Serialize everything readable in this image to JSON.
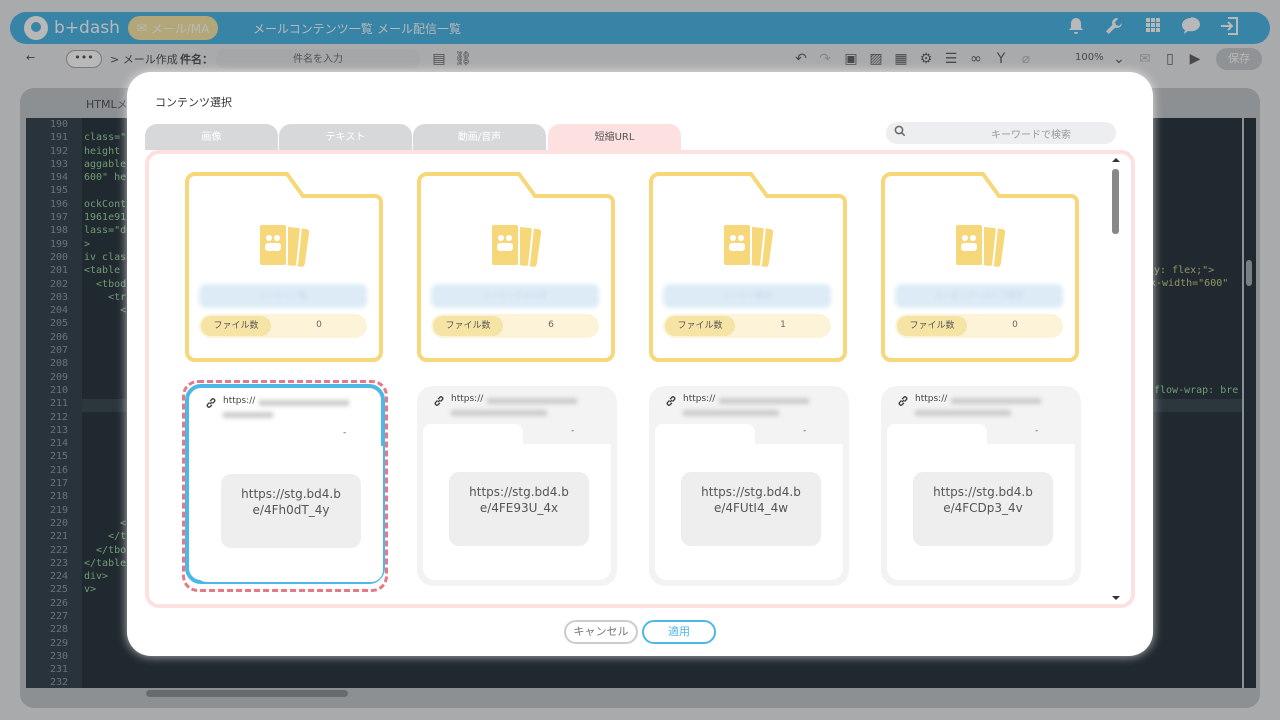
{
  "app": {
    "logo_text": "b+dash",
    "nav": {
      "mail_pill": "メール/MA",
      "item1": "メールコンテンツ一覧",
      "item2": "メール配信一覧"
    }
  },
  "subbar": {
    "back": "←",
    "dots": "•••",
    "breadcrumb": "> メール作成",
    "subject_label": "件名：",
    "subject_placeholder": "件名を入力",
    "zoom": "100%",
    "save": "保存"
  },
  "editor": {
    "tab_label": "HTMLメ",
    "line_numbers": [
      "190",
      "191",
      "192",
      "193",
      "194",
      "195",
      "196",
      "197",
      "198",
      "199",
      "200",
      "201",
      "202",
      "203",
      "204",
      "205",
      "206",
      "207",
      "208",
      "209",
      "210",
      "211",
      "212",
      "213",
      "214",
      "215",
      "216",
      "217",
      "218",
      "219",
      "220",
      "221",
      "222",
      "223",
      "224",
      "225",
      "226",
      "227",
      "228",
      "229",
      "230",
      "231",
      "232"
    ],
    "code_lines": [
      "",
      "class=\"",
      "height",
      "aggable",
      "600\" he",
      "",
      "ockCont",
      "1961e91",
      "lass=\"d",
      ">",
      "iv clas",
      "<table",
      "  <tbod",
      "    <tr",
      "      <",
      "",
      "",
      "",
      "",
      "",
      "",
      "",
      "",
      "",
      "",
      "",
      "",
      "",
      "",
      "",
      "      <",
      "    </t",
      "  </tbo",
      "</table",
      "div>",
      "v>",
      "",
      "",
      "",
      "",
      "",
      "",
      ""
    ],
    "right_code": {
      "line201": "y: flex;\">",
      "line202": "k-width=\"600\"",
      "line210": "flow-wrap: bre"
    }
  },
  "modal": {
    "title": "コンテンツ選択",
    "tabs": [
      {
        "label": "画像"
      },
      {
        "label": "テキスト"
      },
      {
        "label": "動画/音声"
      },
      {
        "label": "短縮URL"
      }
    ],
    "search_placeholder": "キーワードで検索",
    "folders": [
      {
        "name": "ムービー一覧",
        "count_label": "ファイル数",
        "count": "0"
      },
      {
        "name": "ムービーフォルダ",
        "count_label": "ファイル数",
        "count": "6"
      },
      {
        "name": "ムービー素材",
        "count_label": "ファイル数",
        "count": "1"
      },
      {
        "name": "ムービーアーカイブ素材",
        "count_label": "ファイル数",
        "count": "0"
      }
    ],
    "urls": [
      {
        "prefix": "https://",
        "dash": "-",
        "short_line1": "https://stg.bd4.b",
        "short_line2": "e/4Fh0dT_4y"
      },
      {
        "prefix": "https://",
        "dash": "-",
        "short_line1": "https://stg.bd4.b",
        "short_line2": "e/4FE93U_4x"
      },
      {
        "prefix": "https://",
        "dash": "-",
        "short_line1": "https://stg.bd4.b",
        "short_line2": "e/4FUtI4_4w"
      },
      {
        "prefix": "https://",
        "dash": "-",
        "short_line1": "https://stg.bd4.b",
        "short_line2": "e/4FCDp3_4v"
      }
    ],
    "cancel": "キャンセル",
    "apply": "適用"
  },
  "colors": {
    "brand": "#4db8e8",
    "folder": "#f6d77a",
    "selected_ring": "#e77886",
    "tab_active": "#fde0e0"
  }
}
